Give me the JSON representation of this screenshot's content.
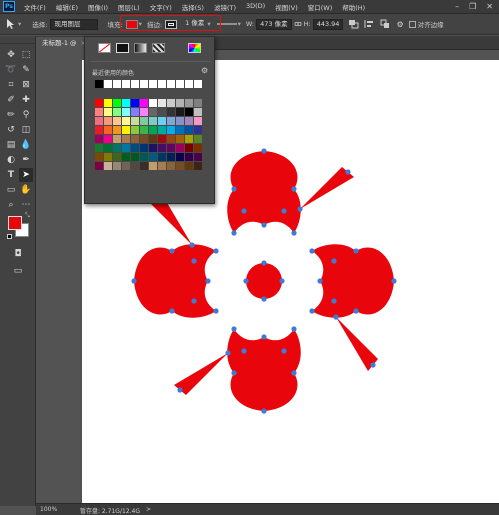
{
  "menu": {
    "logo": "Ps",
    "items": [
      "文件(F)",
      "编辑(E)",
      "图像(I)",
      "图层(L)",
      "文字(Y)",
      "选择(S)",
      "滤镜(T)",
      "3D(D)",
      "视图(V)",
      "窗口(W)",
      "帮助(H)"
    ],
    "window_controls": [
      "–",
      "❐",
      "✕"
    ]
  },
  "options": {
    "select_label": "选择:",
    "select_value": "现用图层",
    "fill_label": "填充:",
    "fill_color": "#e8050b",
    "stroke_label": "描边:",
    "stroke_width": "1 像素",
    "w_label": "W:",
    "w_value": "473 像素",
    "h_label": "H:",
    "h_value": "443.94",
    "align_edges": "对齐边缘"
  },
  "document": {
    "tab_title": "未标题-1 @",
    "close": "×"
  },
  "toolbar": {
    "tools": [
      "move",
      "marquee",
      "lasso",
      "quick-select",
      "crop",
      "frame",
      "eyedropper",
      "spot-heal",
      "brush",
      "clone-stamp",
      "history-brush",
      "eraser",
      "gradient",
      "blur",
      "dodge",
      "pen",
      "type",
      "path-select",
      "shape",
      "hand",
      "zoom",
      "more"
    ],
    "foreground": "#e8050b",
    "background": "#ffffff"
  },
  "fill_popup": {
    "recent_label": "最近使用的颜色",
    "recent_colors": [
      "#000000",
      "#ffffff",
      "#ffffff",
      "#ffffff",
      "#ffffff",
      "#ffffff",
      "#ffffff",
      "#ffffff",
      "#ffffff",
      "#ffffff",
      "#ffffff",
      "#ffffff"
    ],
    "swatch_colors": [
      "#ff0000",
      "#ffff00",
      "#00ff00",
      "#00ffff",
      "#0000ff",
      "#ff00ff",
      "#ffffff",
      "#e6e6e6",
      "#cccccc",
      "#b3b3b3",
      "#999999",
      "#808080",
      "#ff8080",
      "#ffff80",
      "#80ff80",
      "#80ffff",
      "#8080ff",
      "#ff80ff",
      "#666666",
      "#4d4d4d",
      "#333333",
      "#1a1a1a",
      "#000000",
      "#bfbfbf",
      "#f26d7d",
      "#f7977a",
      "#fdc68a",
      "#fff79a",
      "#c4df9b",
      "#82ca9d",
      "#7bcdc8",
      "#6ecff6",
      "#7ea7d8",
      "#8493ca",
      "#a187be",
      "#f49ac2",
      "#ed1c24",
      "#f26522",
      "#f7941d",
      "#fff200",
      "#8dc63f",
      "#39b54a",
      "#00a651",
      "#00a99d",
      "#00aeef",
      "#0072bc",
      "#0054a6",
      "#2e3192",
      "#9e005d",
      "#ec008c",
      "#c69c6d",
      "#a67c52",
      "#8c6239",
      "#754c24",
      "#603913",
      "#9e0b0f",
      "#a0410d",
      "#a3620a",
      "#aba000",
      "#598527",
      "#197b30",
      "#007236",
      "#00746b",
      "#0076a3",
      "#004b80",
      "#003471",
      "#1b1464",
      "#440e62",
      "#630460",
      "#9e005d",
      "#790000",
      "#7b2e00",
      "#7d4900",
      "#827b00",
      "#406618",
      "#005e20",
      "#005826",
      "#005952",
      "#005b7f",
      "#003663",
      "#002157",
      "#0d004c",
      "#32004b",
      "#4b0049",
      "#7b0046",
      "#c7b299",
      "#998675",
      "#736357",
      "#534741",
      "#37302a",
      "#c69c6d",
      "#a67c52",
      "#8c6239",
      "#754c24",
      "#603913",
      "#3c2415"
    ]
  },
  "status": {
    "zoom": "100%",
    "doc_info": "暂存盘: 2.71G/12.4G",
    "arrow": ">"
  }
}
